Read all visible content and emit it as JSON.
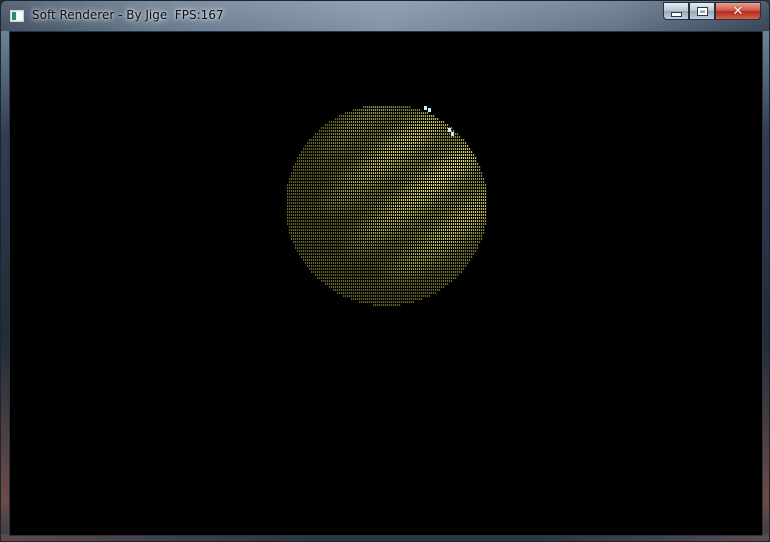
{
  "window": {
    "title": "Soft Renderer - By Jige  FPS:167",
    "caption_buttons": {
      "minimize_icon": "minimize-icon",
      "maximize_icon": "maximize-icon",
      "close_icon": "close-icon",
      "close_glyph": "✕"
    }
  },
  "viewport": {
    "background": "#000000",
    "sphere_light_color": "#e8e47a",
    "sphere_dark_color": "#4a4a1c",
    "highlight_color": "#cfe8ff"
  }
}
